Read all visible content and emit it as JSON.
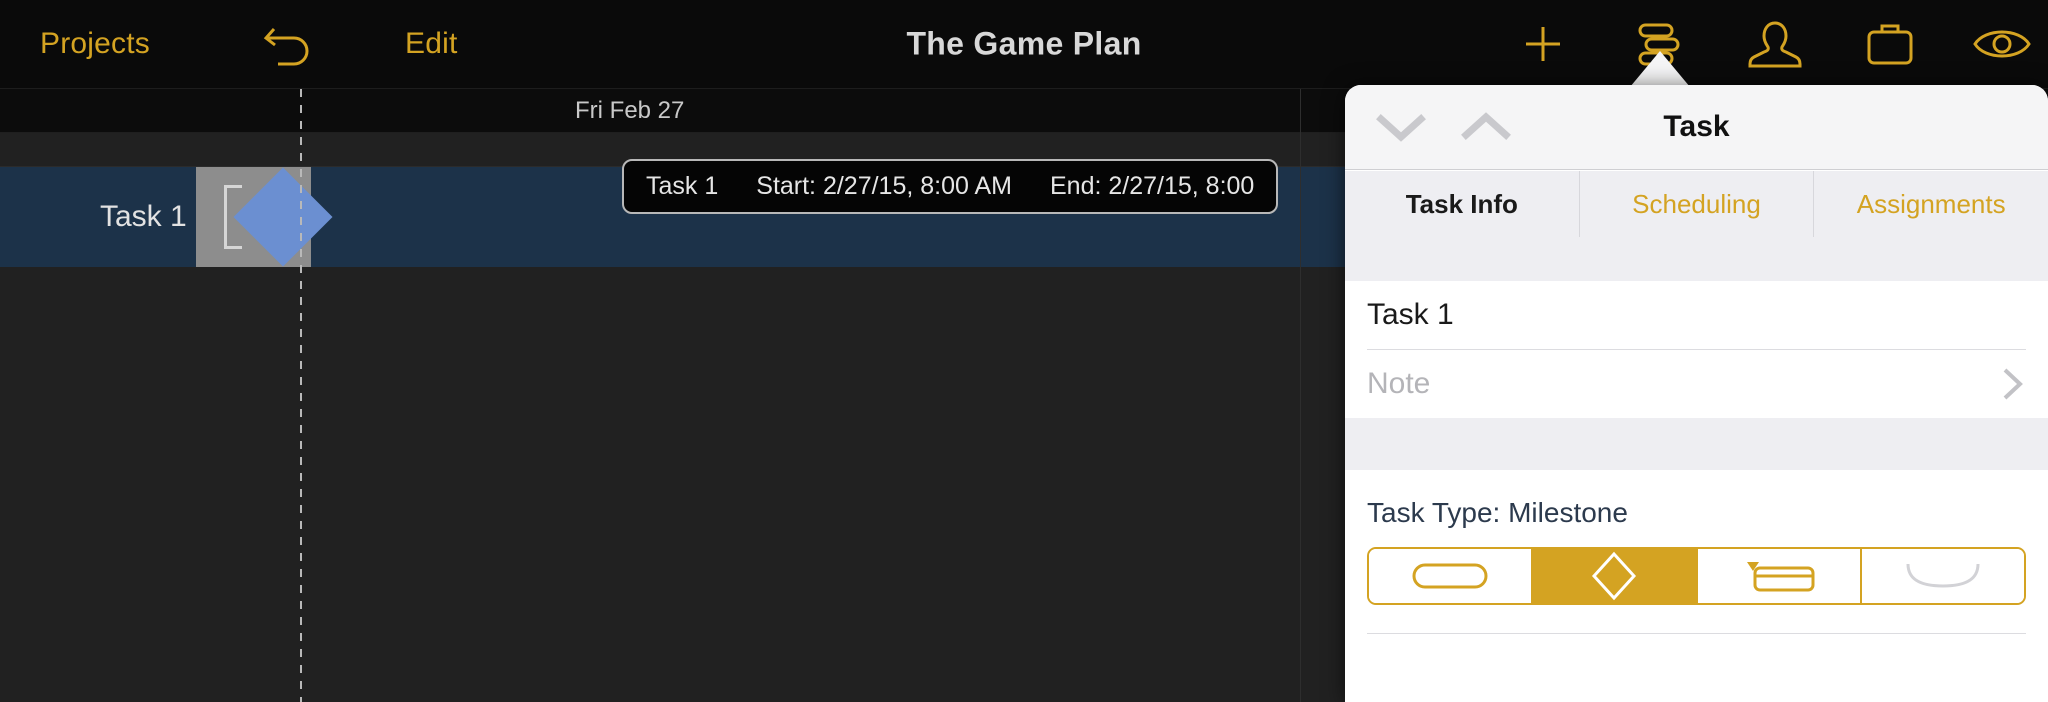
{
  "toolbar": {
    "projects_label": "Projects",
    "edit_label": "Edit",
    "document_title": "The Game Plan",
    "icons": {
      "undo": "undo-arrow-icon",
      "add": "plus-icon",
      "tasks": "task-list-icon",
      "people": "person-icon",
      "resources": "briefcase-icon",
      "view": "eye-icon"
    }
  },
  "gantt": {
    "date_header": "Fri Feb 27",
    "rows": [
      {
        "name": "Task 1",
        "shape": "milestone",
        "color": "#6b8fd1",
        "selected": true
      }
    ],
    "info_bar": {
      "name": "Task 1",
      "start": "Start: 2/27/15, 8:00 AM",
      "end": "End: 2/27/15, 8:00"
    },
    "colors": {
      "selected_row": "#1c3249",
      "canvas": "#212121",
      "milestone": "#6b8fd1",
      "handle": "#8d8d8d"
    }
  },
  "popover": {
    "title": "Task",
    "nav_prev_icon": "chevron-down-icon",
    "nav_next_icon": "chevron-up-icon",
    "tabs": [
      {
        "label": "Task Info",
        "active": true
      },
      {
        "label": "Scheduling",
        "active": false
      },
      {
        "label": "Assignments",
        "active": false
      }
    ],
    "fields": {
      "name_value": "Task 1",
      "note_placeholder": "Note",
      "note_disclosure_icon": "chevron-right-icon"
    },
    "task_type": {
      "label": "Task Type: Milestone",
      "options": [
        {
          "name": "task",
          "selected": false
        },
        {
          "name": "milestone",
          "selected": true
        },
        {
          "name": "group",
          "selected": false
        },
        {
          "name": "hammock",
          "selected": false
        }
      ]
    },
    "accent_color": "#d4a322"
  }
}
